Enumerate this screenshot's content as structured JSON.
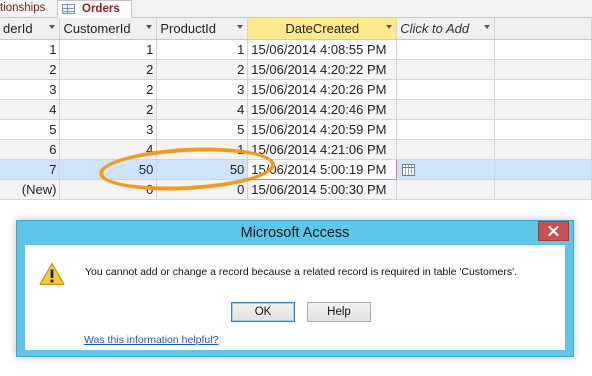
{
  "tabs": [
    {
      "label": "tionships"
    },
    {
      "label": "Orders",
      "icon": "table-icon"
    }
  ],
  "columns": [
    {
      "label": "derId"
    },
    {
      "label": "CustomerId"
    },
    {
      "label": "ProductId"
    },
    {
      "label": "DateCreated"
    },
    {
      "label": "Click to Add"
    }
  ],
  "rows": [
    {
      "order": "1",
      "customer": "1",
      "product": "1",
      "date": "15/06/2014 4:08:55 PM"
    },
    {
      "order": "2",
      "customer": "2",
      "product": "2",
      "date": "15/06/2014 4:20:22 PM"
    },
    {
      "order": "3",
      "customer": "2",
      "product": "3",
      "date": "15/06/2014 4:20:26 PM"
    },
    {
      "order": "4",
      "customer": "2",
      "product": "4",
      "date": "15/06/2014 4:20:46 PM"
    },
    {
      "order": "5",
      "customer": "3",
      "product": "5",
      "date": "15/06/2014 4:20:59 PM"
    },
    {
      "order": "6",
      "customer": "4",
      "product": "1",
      "date": "15/06/2014 4:21:06 PM"
    },
    {
      "order": "7",
      "customer": "50",
      "product": "50",
      "date": "15/06/2014 5:00:19 PM",
      "selected": true
    },
    {
      "order": "(New)",
      "customer": "0",
      "product": "0",
      "date": "15/06/2014 5:00:30 PM"
    }
  ],
  "dialog": {
    "title": "Microsoft Access",
    "message": "You cannot add or change a record because a related record is required in table 'Customers'.",
    "ok_label": "OK",
    "help_label": "Help",
    "help_link": "Was this information helpful?"
  },
  "colors": {
    "dialog_frame": "#5fc6ea",
    "close_button": "#c75050",
    "annotation": "#f39a1e",
    "selected_row": "#cfe4fb",
    "header_highlight": "#fce98a"
  }
}
